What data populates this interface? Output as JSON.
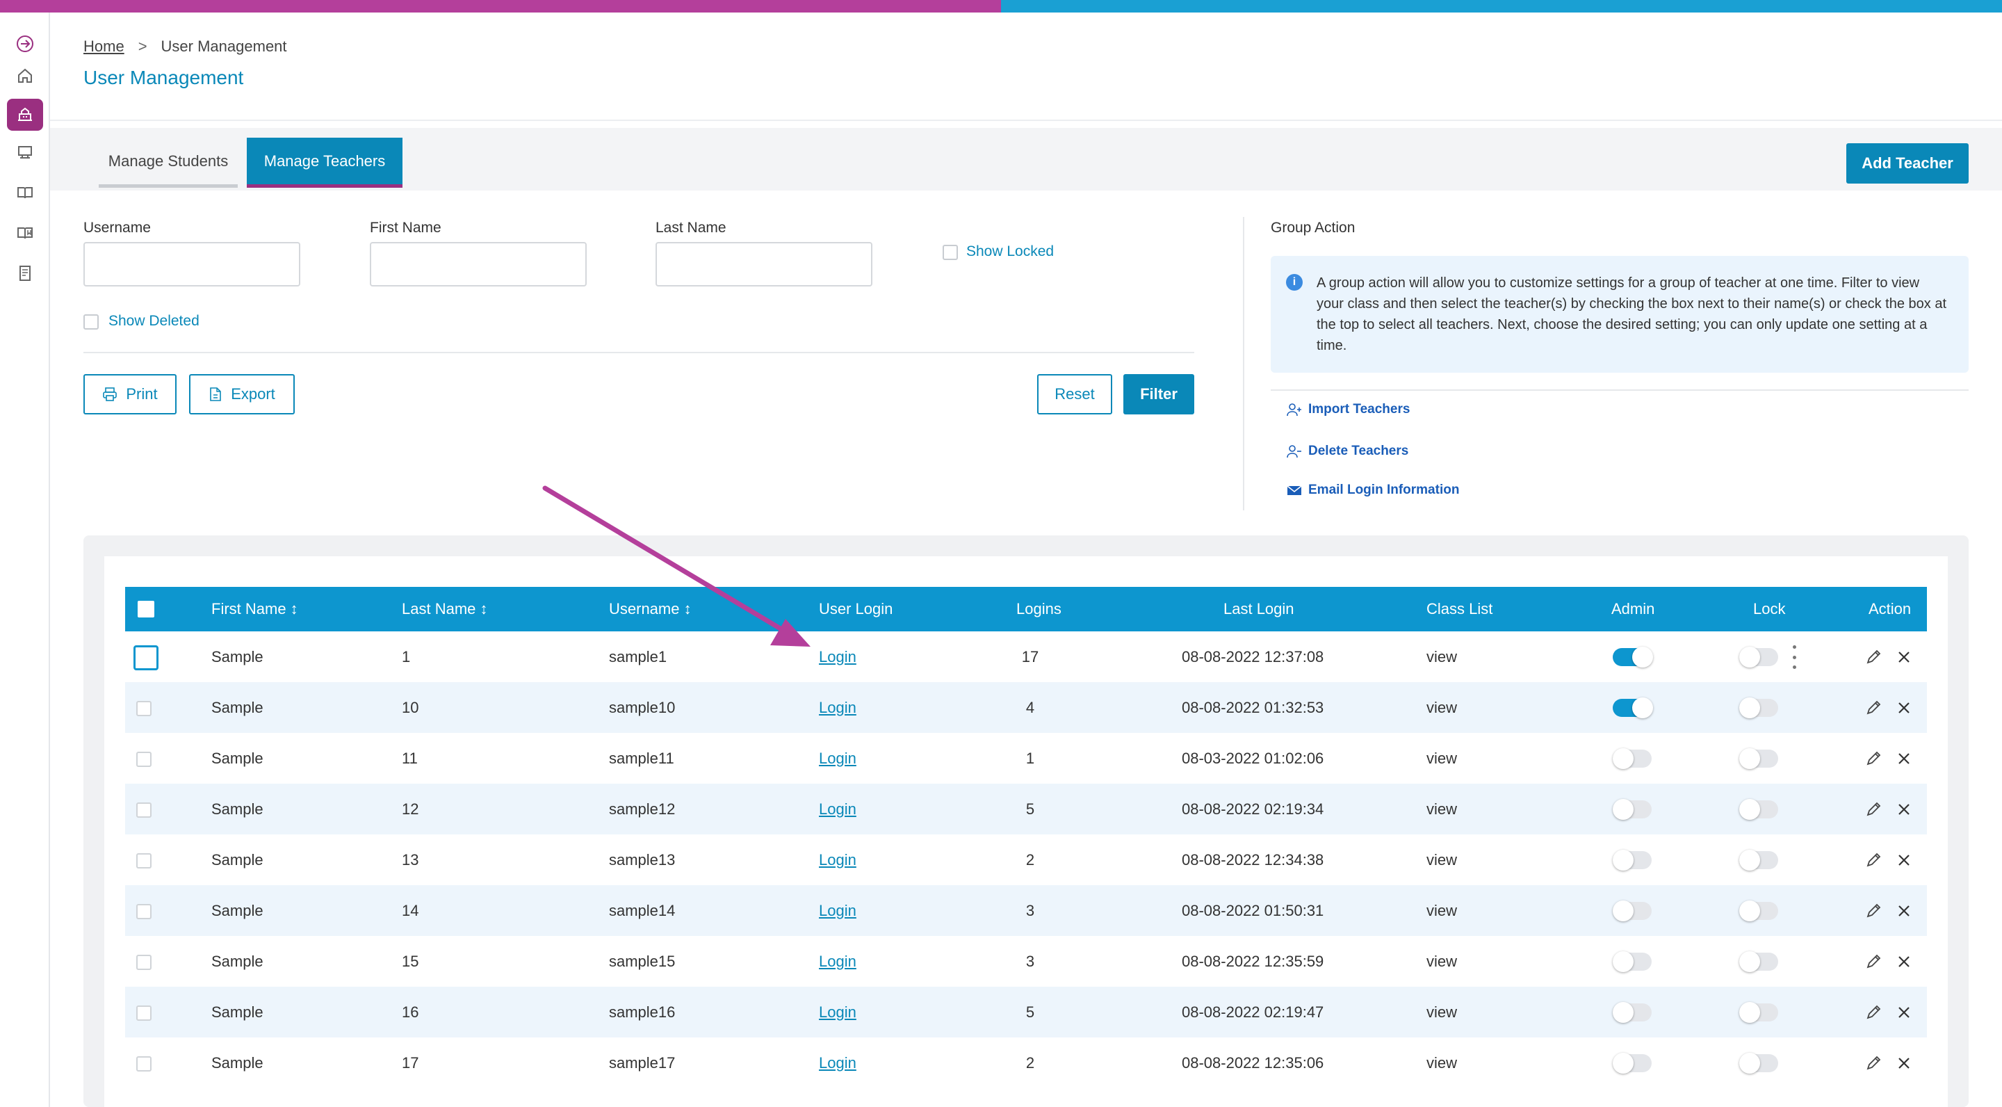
{
  "breadcrumb": {
    "home": "Home",
    "separator": ">",
    "current": "User Management"
  },
  "page_title": "User Management",
  "tabs": [
    {
      "label": "Manage Students",
      "active": false
    },
    {
      "label": "Manage Teachers",
      "active": true
    }
  ],
  "add_teacher_label": "Add Teacher",
  "filters": {
    "username_label": "Username",
    "first_name_label": "First Name",
    "last_name_label": "Last Name",
    "show_locked_label": "Show Locked",
    "show_deleted_label": "Show Deleted"
  },
  "buttons": {
    "print": "Print",
    "export": "Export",
    "reset": "Reset",
    "filter": "Filter"
  },
  "group_action": {
    "title": "Group Action",
    "info": "A group action will allow you to customize settings for a group of teacher at one time. Filter to view your class and then select the teacher(s) by checking the box next to their name(s) or check the box at the top to select all teachers. Next, choose the desired setting; you can only update one setting at a time.",
    "links": [
      "Import Teachers",
      "Delete Teachers",
      "Email Login Information"
    ]
  },
  "table": {
    "headers": {
      "first_name": "First Name ↕",
      "last_name": "Last Name ↕",
      "username": "Username ↕",
      "user_login": "User Login",
      "logins": "Logins",
      "last_login": "Last Login",
      "class_list": "Class List",
      "admin": "Admin",
      "lock": "Lock",
      "action": "Action"
    },
    "rows": [
      {
        "first": "Sample",
        "last": "1",
        "username": "sample1",
        "login": "Login",
        "logins": "17",
        "last_login": "08-08-2022 12:37:08",
        "class_list": "view",
        "admin": true,
        "lock": false
      },
      {
        "first": "Sample",
        "last": "10",
        "username": "sample10",
        "login": "Login",
        "logins": "4",
        "last_login": "08-08-2022 01:32:53",
        "class_list": "view",
        "admin": true,
        "lock": false
      },
      {
        "first": "Sample",
        "last": "11",
        "username": "sample11",
        "login": "Login",
        "logins": "1",
        "last_login": "08-03-2022 01:02:06",
        "class_list": "view",
        "admin": false,
        "lock": false
      },
      {
        "first": "Sample",
        "last": "12",
        "username": "sample12",
        "login": "Login",
        "logins": "5",
        "last_login": "08-08-2022 02:19:34",
        "class_list": "view",
        "admin": false,
        "lock": false
      },
      {
        "first": "Sample",
        "last": "13",
        "username": "sample13",
        "login": "Login",
        "logins": "2",
        "last_login": "08-08-2022 12:34:38",
        "class_list": "view",
        "admin": false,
        "lock": false
      },
      {
        "first": "Sample",
        "last": "14",
        "username": "sample14",
        "login": "Login",
        "logins": "3",
        "last_login": "08-08-2022 01:50:31",
        "class_list": "view",
        "admin": false,
        "lock": false
      },
      {
        "first": "Sample",
        "last": "15",
        "username": "sample15",
        "login": "Login",
        "logins": "3",
        "last_login": "08-08-2022 12:35:59",
        "class_list": "view",
        "admin": false,
        "lock": false
      },
      {
        "first": "Sample",
        "last": "16",
        "username": "sample16",
        "login": "Login",
        "logins": "5",
        "last_login": "08-08-2022 02:19:47",
        "class_list": "view",
        "admin": false,
        "lock": false
      },
      {
        "first": "Sample",
        "last": "17",
        "username": "sample17",
        "login": "Login",
        "logins": "2",
        "last_login": "08-08-2022 12:35:06",
        "class_list": "view",
        "admin": false,
        "lock": false
      }
    ]
  },
  "colors": {
    "accent": "#0a88b8",
    "brand": "#9a2f80",
    "header": "#0d96cf",
    "annotation_arrow": "#b43f9b"
  },
  "icons": {
    "sidebar": [
      "expand-icon",
      "home-icon",
      "school-icon",
      "classroom-icon",
      "book-icon",
      "reading-icon",
      "report-icon"
    ],
    "row_actions": [
      "pencil-icon",
      "close-icon"
    ]
  }
}
